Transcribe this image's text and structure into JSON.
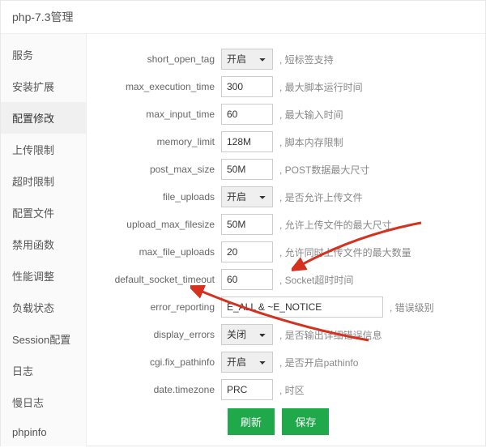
{
  "header": {
    "title": "php-7.3管理"
  },
  "sidebar": {
    "items": [
      {
        "label": "服务"
      },
      {
        "label": "安装扩展"
      },
      {
        "label": "配置修改"
      },
      {
        "label": "上传限制"
      },
      {
        "label": "超时限制"
      },
      {
        "label": "配置文件"
      },
      {
        "label": "禁用函数"
      },
      {
        "label": "性能调整"
      },
      {
        "label": "负载状态"
      },
      {
        "label": "Session配置"
      },
      {
        "label": "日志"
      },
      {
        "label": "慢日志"
      },
      {
        "label": "phpinfo"
      }
    ],
    "active_index": 2
  },
  "form": {
    "rows": [
      {
        "label": "short_open_tag",
        "type": "select",
        "value": "开启",
        "desc": "短标签支持"
      },
      {
        "label": "max_execution_time",
        "type": "text",
        "value": "300",
        "desc": "最大脚本运行时间"
      },
      {
        "label": "max_input_time",
        "type": "text",
        "value": "60",
        "desc": "最大输入时间"
      },
      {
        "label": "memory_limit",
        "type": "text",
        "value": "128M",
        "desc": "脚本内存限制"
      },
      {
        "label": "post_max_size",
        "type": "text",
        "value": "50M",
        "desc": "POST数据最大尺寸"
      },
      {
        "label": "file_uploads",
        "type": "select",
        "value": "开启",
        "desc": "是否允许上传文件"
      },
      {
        "label": "upload_max_filesize",
        "type": "text",
        "value": "50M",
        "desc": "允许上传文件的最大尺寸"
      },
      {
        "label": "max_file_uploads",
        "type": "text",
        "value": "20",
        "desc": "允许同时上传文件的最大数量"
      },
      {
        "label": "default_socket_timeout",
        "type": "text",
        "value": "60",
        "desc": "Socket超时时间"
      },
      {
        "label": "error_reporting",
        "type": "text_long",
        "value": "E_ALL & ~E_NOTICE",
        "desc": "错误级别"
      },
      {
        "label": "display_errors",
        "type": "select",
        "value": "关闭",
        "desc": "是否输出详细错误信息"
      },
      {
        "label": "cgi.fix_pathinfo",
        "type": "select",
        "value": "开启",
        "desc": "是否开启pathinfo"
      },
      {
        "label": "date.timezone",
        "type": "text",
        "value": "PRC",
        "desc": "时区"
      }
    ]
  },
  "actions": {
    "refresh": "刷新",
    "save": "保存"
  },
  "select_options": [
    "开启",
    "关闭"
  ]
}
